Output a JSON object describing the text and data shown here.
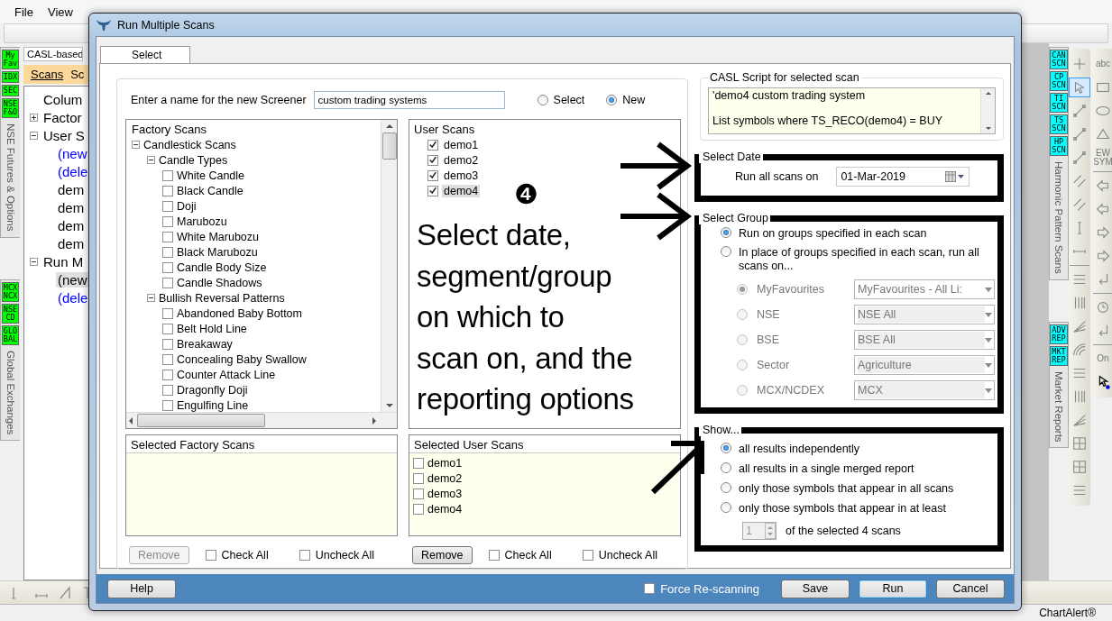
{
  "menu": [
    {
      "label": "File"
    },
    {
      "label": "View"
    }
  ],
  "left_strip": {
    "groups": [
      {
        "badges": [
          "My Fav",
          "IDX",
          "SEC",
          "NSE F&O"
        ],
        "label": "NSE Futures & Options",
        "color": "#00ff00"
      },
      {
        "badges": [
          "MCX NCX",
          "NSE CD",
          "GLOBAL"
        ],
        "label": "Global Exchanges",
        "color": "#00ff00"
      }
    ]
  },
  "scanner_panel": {
    "title": "CASL-based",
    "tabs": [
      {
        "label": "Scans",
        "selected": true
      },
      {
        "label": "Sc",
        "selected": false
      }
    ],
    "tree": [
      {
        "label": "Colum",
        "kind": "item",
        "selected": false
      },
      {
        "label": "Factor",
        "kind": "item",
        "selected": false,
        "expanded": false
      },
      {
        "label": "User S",
        "kind": "item",
        "selected": false,
        "expanded": true,
        "children": [
          {
            "label": "(new",
            "kind": "command",
            "selected": false
          },
          {
            "label": "(dele",
            "kind": "command",
            "selected": false
          },
          {
            "label": "dem",
            "kind": "item",
            "selected": false
          },
          {
            "label": "dem",
            "kind": "item",
            "selected": false
          },
          {
            "label": "dem",
            "kind": "item",
            "selected": false
          },
          {
            "label": "dem",
            "kind": "item",
            "selected": false
          }
        ]
      },
      {
        "label": "Run M",
        "kind": "item",
        "selected": false,
        "expanded": true,
        "children": [
          {
            "label": "(new",
            "kind": "item",
            "selected": true
          },
          {
            "label": "(dele",
            "kind": "command",
            "selected": false
          }
        ]
      }
    ]
  },
  "right_strip": {
    "groups": [
      {
        "badges": [
          "CAN SCN",
          "CP SCN",
          "TI SCN",
          "TS SCN",
          "HP SCN"
        ],
        "label": "Harmonic Pattern Scans",
        "color": "#00ffff"
      },
      {
        "badges": [
          "ADV REP",
          "MKT REP"
        ],
        "label": "Market Reports",
        "color": "#00ffff"
      }
    ]
  },
  "drawing_tools": [
    [
      {
        "kind": "plus",
        "selected": false
      },
      {
        "kind": "pointer",
        "selected": true
      },
      {
        "kind": "line",
        "selected": false
      },
      {
        "kind": "line",
        "selected": false
      },
      {
        "kind": "line",
        "selected": false
      },
      {
        "kind": "channel",
        "selected": false
      },
      {
        "kind": "channel",
        "selected": false
      },
      {
        "kind": "vline",
        "selected": false
      },
      {
        "kind": "hline",
        "selected": false
      },
      {
        "kind": "break"
      },
      {
        "kind": "fib",
        "selected": false
      },
      {
        "kind": "vgrid",
        "selected": false
      },
      {
        "kind": "fan",
        "selected": false
      },
      {
        "kind": "arc",
        "selected": false
      },
      {
        "kind": "fib",
        "selected": false
      },
      {
        "kind": "vgrid",
        "selected": false
      },
      {
        "kind": "fan",
        "selected": false
      },
      {
        "kind": "grid",
        "selected": false
      },
      {
        "kind": "grid",
        "selected": false
      },
      {
        "kind": "fib",
        "selected": false
      }
    ],
    [
      {
        "kind": "text",
        "label": "abc",
        "selected": false
      },
      {
        "kind": "rect",
        "selected": false
      },
      {
        "kind": "ellipse",
        "selected": false
      },
      {
        "kind": "triangle",
        "selected": false
      },
      {
        "kind": "text",
        "label": "EW SYM",
        "selected": false
      },
      {
        "kind": "break"
      },
      {
        "kind": "arrow-left",
        "selected": false
      },
      {
        "kind": "arrow-left",
        "selected": false
      },
      {
        "kind": "arrow-right",
        "selected": false
      },
      {
        "kind": "arrow-right",
        "selected": false
      },
      {
        "kind": "turn",
        "selected": false
      },
      {
        "kind": "break"
      },
      {
        "kind": "timer",
        "selected": false
      },
      {
        "kind": "turn",
        "selected": false
      },
      {
        "kind": "break"
      },
      {
        "kind": "text",
        "label": "On",
        "selected": false
      },
      {
        "kind": "cursor",
        "selected": false
      }
    ]
  ],
  "status_bar": {
    "text": "ChartAlert®"
  },
  "dialog": {
    "title": "Run Multiple Scans",
    "tabs": [
      {
        "label": "Select",
        "selected": true
      }
    ],
    "name_label": "Enter a name for the new Screener",
    "name_value": "custom trading systems",
    "mode_options": [
      {
        "label": "Select",
        "selected": false
      },
      {
        "label": "New",
        "selected": true
      }
    ],
    "factory_scans": {
      "title": "Factory Scans",
      "tree": [
        {
          "label": "Candlestick Scans",
          "expanded": true,
          "children": [
            {
              "label": "Candle Types",
              "expanded": true,
              "children": [
                {
                  "label": "White Candle",
                  "checked": false
                },
                {
                  "label": "Black Candle",
                  "checked": false
                },
                {
                  "label": "Doji",
                  "checked": false
                },
                {
                  "label": "Marubozu",
                  "checked": false
                },
                {
                  "label": "White Marubozu",
                  "checked": false
                },
                {
                  "label": "Black Marubozu",
                  "checked": false
                },
                {
                  "label": "Candle Body Size",
                  "checked": false
                },
                {
                  "label": "Candle Shadows",
                  "checked": false
                }
              ]
            },
            {
              "label": "Bullish Reversal Patterns",
              "expanded": true,
              "children": [
                {
                  "label": "Abandoned Baby Bottom",
                  "checked": false
                },
                {
                  "label": "Belt Hold Line",
                  "checked": false
                },
                {
                  "label": "Breakaway",
                  "checked": false
                },
                {
                  "label": "Concealing Baby Swallow",
                  "checked": false
                },
                {
                  "label": "Counter Attack Line",
                  "checked": false
                },
                {
                  "label": "Dragonfly Doji",
                  "checked": false
                },
                {
                  "label": "Engulfing Line",
                  "checked": false
                }
              ]
            }
          ]
        }
      ]
    },
    "user_scans": {
      "title": "User Scans",
      "items": [
        {
          "label": "demo1",
          "checked": true,
          "selected": false
        },
        {
          "label": "demo2",
          "checked": true,
          "selected": false
        },
        {
          "label": "demo3",
          "checked": true,
          "selected": false
        },
        {
          "label": "demo4",
          "checked": true,
          "selected": true
        }
      ]
    },
    "selected_factory_scans": {
      "title": "Selected Factory Scans"
    },
    "selected_user_scans": {
      "title": "Selected User Scans",
      "items": [
        {
          "label": "demo1",
          "checked": false
        },
        {
          "label": "demo2",
          "checked": false
        },
        {
          "label": "demo3",
          "checked": false
        },
        {
          "label": "demo4",
          "checked": false
        }
      ]
    },
    "factory_actions": {
      "remove": {
        "label": "Remove",
        "disabled": true
      },
      "check_all": {
        "label": "Check All",
        "checked": false
      },
      "uncheck_all": {
        "label": "Uncheck All",
        "checked": false
      }
    },
    "user_actions": {
      "remove": {
        "label": "Remove",
        "disabled": false
      },
      "check_all": {
        "label": "Check All",
        "checked": false
      },
      "uncheck_all": {
        "label": "Uncheck All",
        "checked": false
      }
    },
    "script": {
      "title": "CASL Script for selected scan",
      "text": "'demo4 custom trading system\n\nList symbols where TS_RECO(demo4) = BUY"
    },
    "select_date": {
      "title": "Select Date",
      "highlighted": true,
      "label": "Run all scans on",
      "value": "01-Mar-2019"
    },
    "select_group": {
      "title": "Select Group",
      "highlighted": true,
      "options": [
        {
          "label": "Run on groups specified in each scan",
          "selected": true
        },
        {
          "label": "In place of groups specified in each scan, run all scans on...",
          "selected": false
        }
      ],
      "sub_options": [
        {
          "label": "MyFavourites",
          "value": "MyFavourites - All Li:",
          "selected": true,
          "disabled": true
        },
        {
          "label": "NSE",
          "value": "NSE All",
          "selected": false,
          "disabled": true
        },
        {
          "label": "BSE",
          "value": "BSE All",
          "selected": false,
          "disabled": true
        },
        {
          "label": "Sector",
          "value": "Agriculture",
          "selected": false,
          "disabled": true
        },
        {
          "label": "MCX/NCDEX",
          "value": "MCX",
          "selected": false,
          "disabled": true
        }
      ]
    },
    "show": {
      "title": "Show...",
      "highlighted": true,
      "options": [
        {
          "label": "all results independently",
          "selected": true
        },
        {
          "label": "all results in a single merged report",
          "selected": false
        },
        {
          "label": "only those symbols that appear in all scans",
          "selected": false
        },
        {
          "label": "only those symbols that appear in at least",
          "selected": false
        }
      ],
      "count": {
        "value": "1",
        "suffix": "of the selected 4 scans",
        "disabled": true
      }
    },
    "footer": {
      "help": "Help",
      "force_rescan": {
        "label": "Force Re-scanning",
        "checked": false
      },
      "buttons": [
        {
          "label": "Save",
          "kind": "normal"
        },
        {
          "label": "Run",
          "kind": "default"
        },
        {
          "label": "Cancel",
          "kind": "normal"
        }
      ]
    }
  },
  "annotation": {
    "step": "❹",
    "text": "Select date,\nsegment/group\non which to\nscan on, and the\nreporting options"
  }
}
